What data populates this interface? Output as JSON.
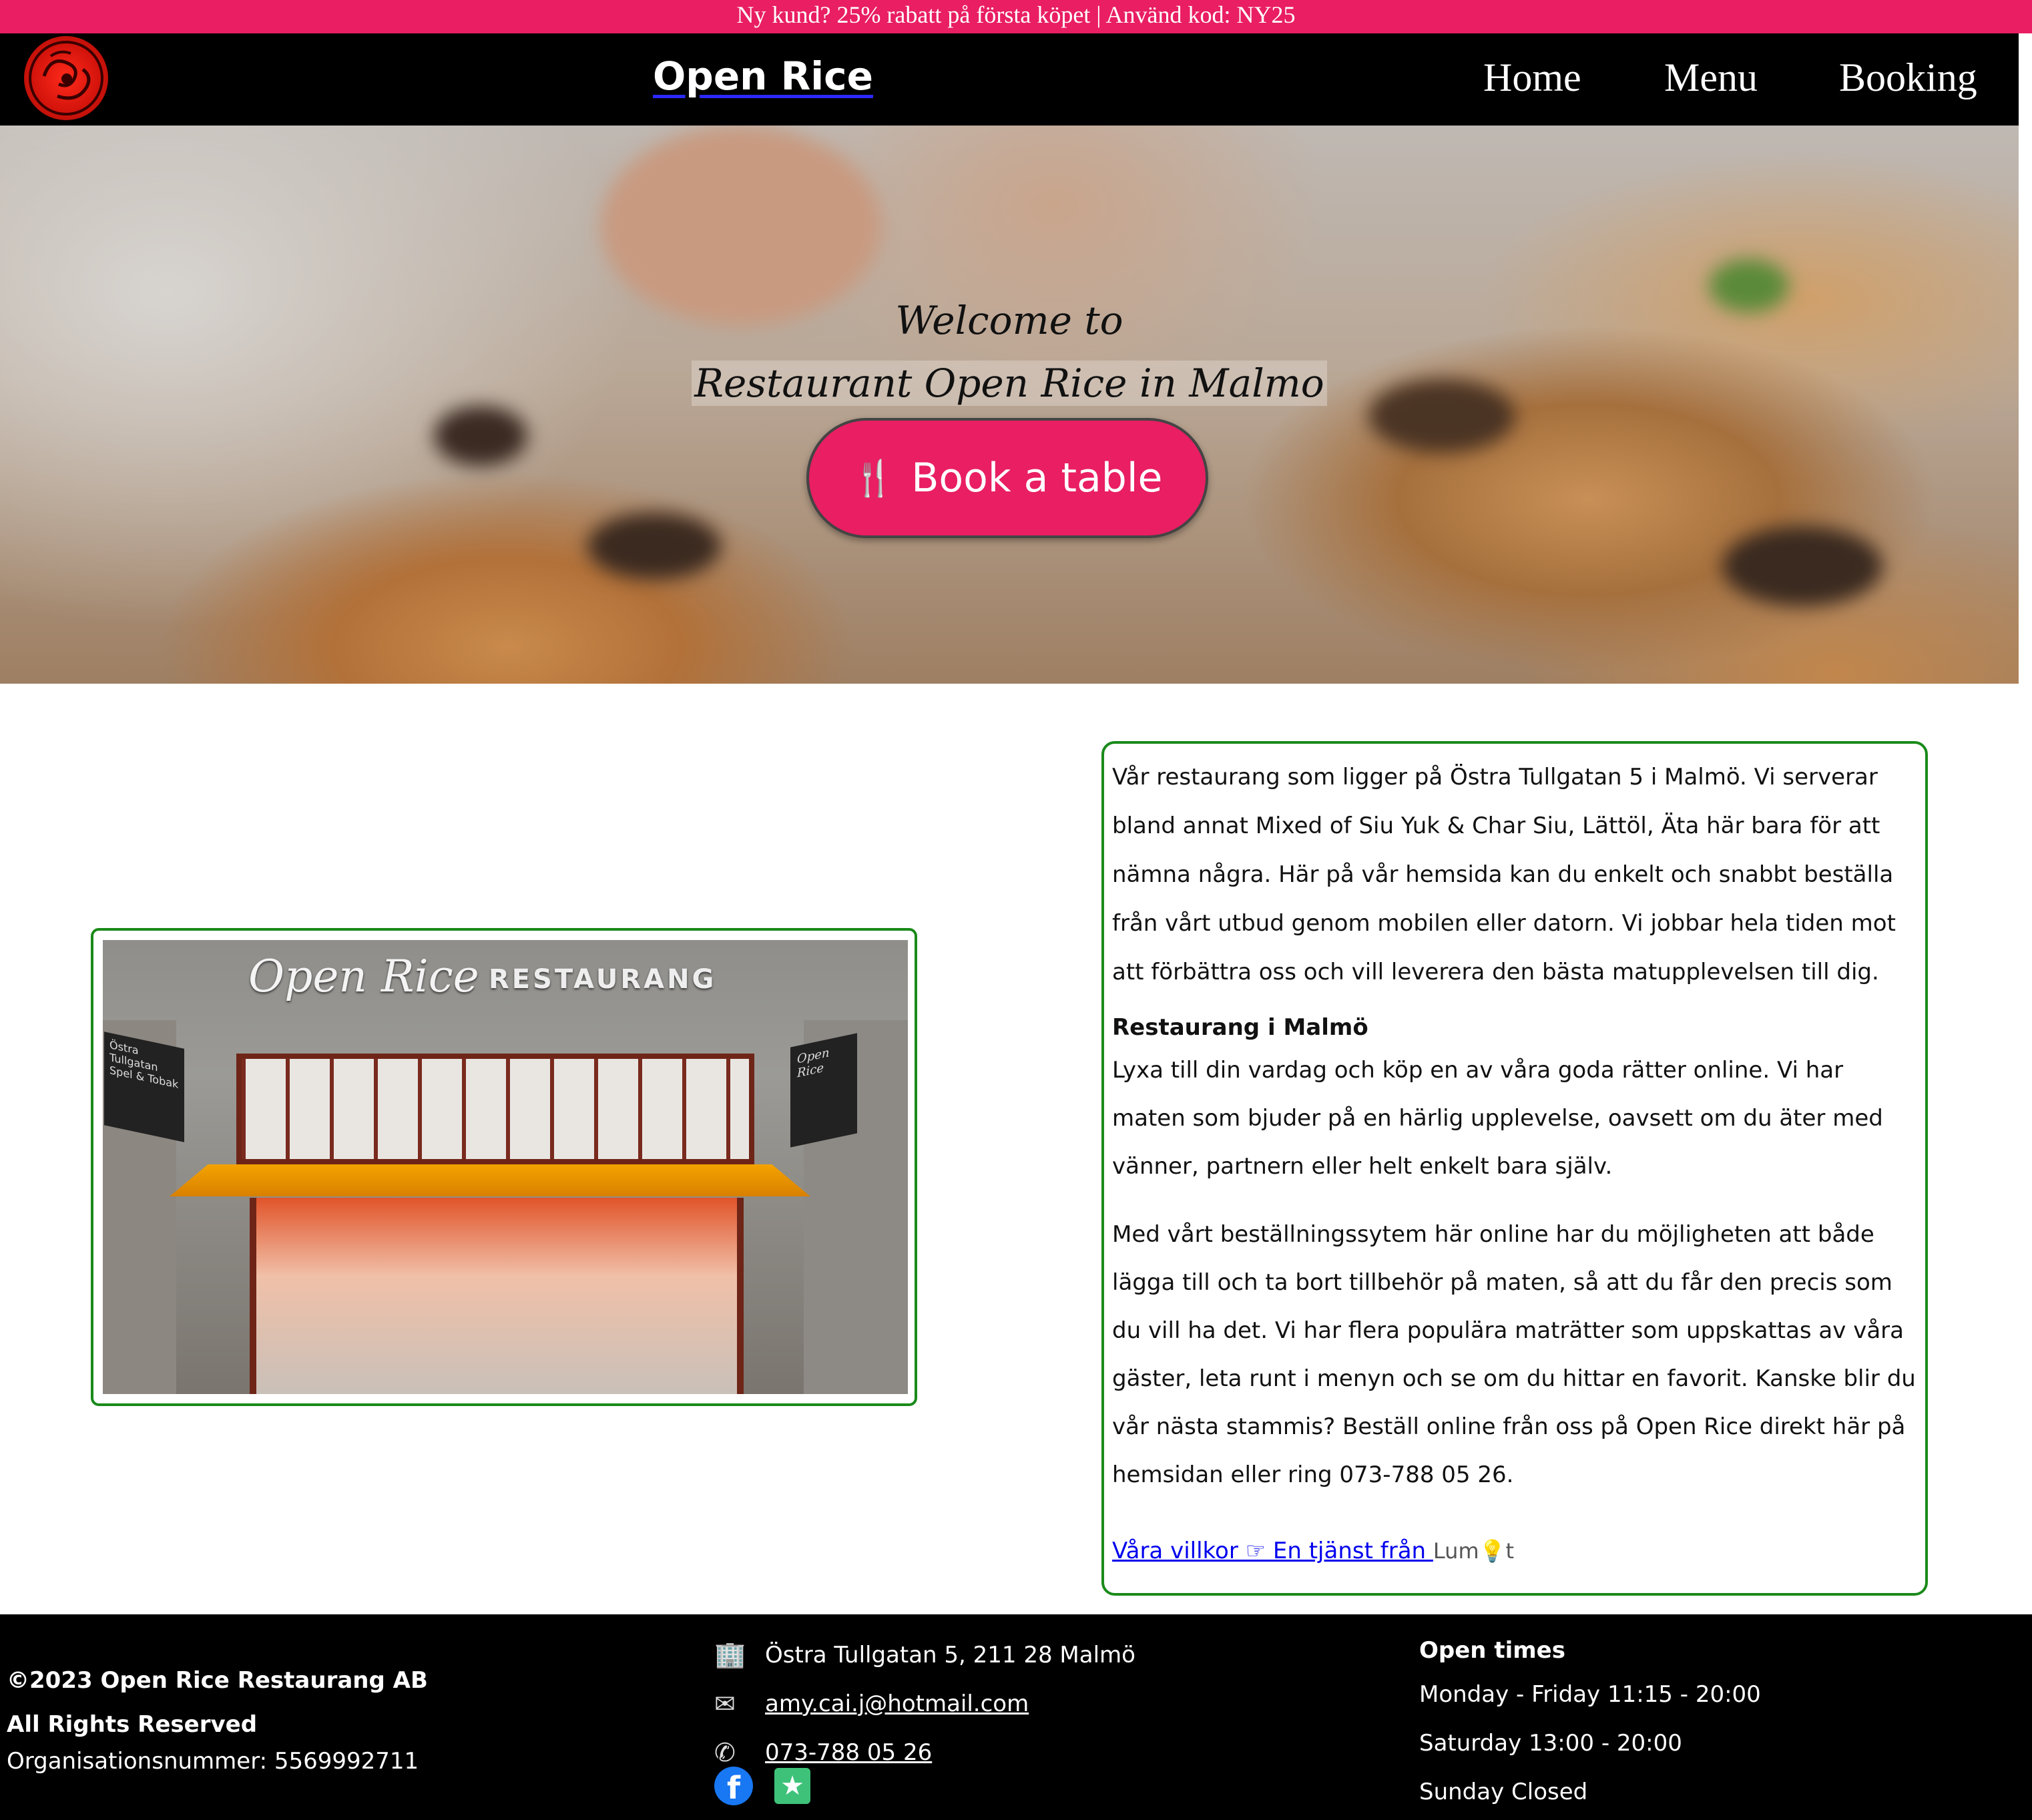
{
  "promo": {
    "text": "Ny kund? 25% rabatt på första köpet | Använd kod: NY25"
  },
  "header": {
    "brand": "Open Rice",
    "nav": [
      {
        "label": "Home"
      },
      {
        "label": "Menu"
      },
      {
        "label": "Booking"
      }
    ]
  },
  "hero": {
    "line1": "Welcome to",
    "line2": "Restaurant Open Rice in Malmo",
    "button_icon": "fork-knife-icon",
    "button_label": "Book a table"
  },
  "photo": {
    "sign_script": "Open Rice",
    "sign_text": "RESTAURANG",
    "plate_left": "Östra Tullgatan Spel & Tobak",
    "plate_right": "Open Rice"
  },
  "about": {
    "p1": "Vår restaurang som ligger på Östra Tullgatan 5 i Malmö. Vi serverar bland annat Mixed of Siu Yuk & Char Siu, Lättöl, Äta här bara för att nämna några. Här på vår hemsida kan du enkelt och snabbt beställa från vårt utbud genom mobilen eller datorn. Vi jobbar hela tiden mot att förbättra oss och vill leverera den bästa matupplevelsen till dig.",
    "heading": "Restaurang i Malmö",
    "p2": "Lyxa till din vardag och köp en av våra goda rätter online. Vi har maten som bjuder på en härlig upplevelse, oavsett om du äter med vänner, partnern eller helt enkelt bara själv.",
    "p3": "Med vårt beställningssytem här online har du möjligheten att både lägga till och ta bort tillbehör på maten, så att du får den precis som du vill ha det. Vi har flera populära maträtter som uppskattas av våra gäster, leta runt i menyn och se om du hittar en favorit. Kanske blir du vår nästa stammis? Beställ online från oss på Open Rice direkt här på hemsidan eller ring 073-788 05 26.",
    "terms_link": "Våra villkor ☞ En tjänst från ",
    "provider_a": "Lum",
    "provider_b": "t"
  },
  "footer": {
    "copyright": "©2023 Open Rice Restaurang AB",
    "rights": "All Rights Reserved",
    "org": "Organisationsnummer: 5569992711",
    "address": "Östra Tullgatan 5, 211 28 Malmö",
    "email": "amy.cai.j@hotmail.com",
    "phone": "073-788 05 26",
    "hours_title": "Open times",
    "hours": [
      "Monday - Friday 11:15 - 20:00",
      "Saturday 13:00 - 20:00",
      "Sunday Closed"
    ]
  },
  "colors": {
    "accent": "#e91e63",
    "frame": "#1a8a1a",
    "header_bg": "#000000"
  }
}
